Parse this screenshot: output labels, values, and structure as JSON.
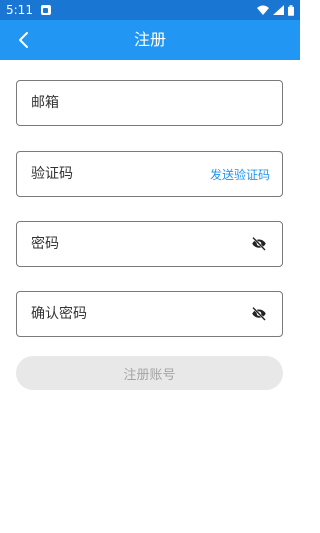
{
  "status_bar": {
    "time": "5:11"
  },
  "app_bar": {
    "title": "注册"
  },
  "form": {
    "email": {
      "placeholder": "邮箱"
    },
    "code": {
      "placeholder": "验证码",
      "send_label": "发送验证码"
    },
    "password": {
      "placeholder": "密码"
    },
    "confirm_password": {
      "placeholder": "确认密码"
    }
  },
  "submit": {
    "label": "注册账号"
  },
  "colors": {
    "primary": "#2196f3",
    "status": "#1976d2",
    "disabled_bg": "#e8e8e8",
    "disabled_text": "#a5a5a5"
  },
  "icons": {
    "back": "chevron-left-icon",
    "visibility": "eye-off-icon"
  }
}
